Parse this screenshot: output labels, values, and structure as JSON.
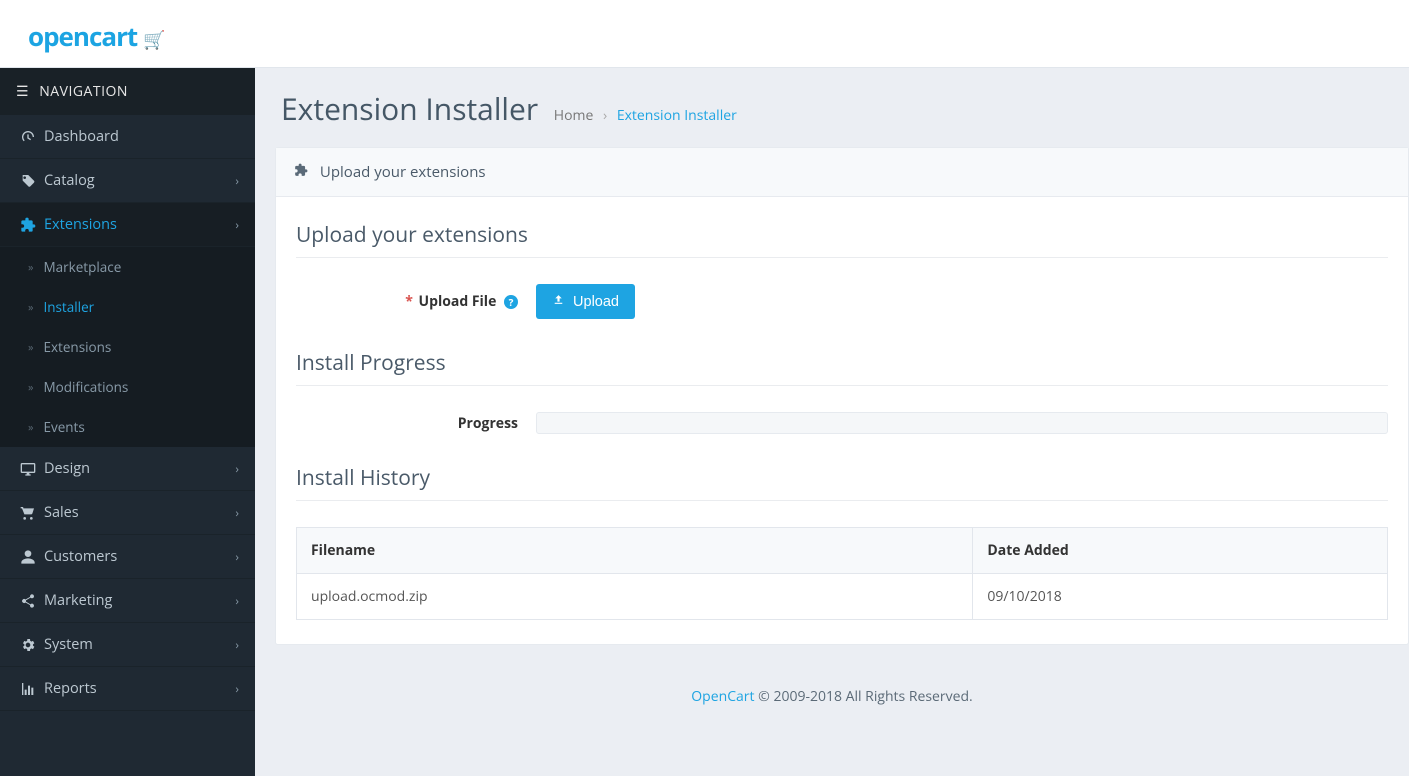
{
  "sidebar": {
    "header": "NAVIGATION",
    "items": [
      {
        "label": "Dashboard",
        "expandable": false
      },
      {
        "label": "Catalog",
        "expandable": true
      },
      {
        "label": "Extensions",
        "expandable": true
      },
      {
        "label": "Design",
        "expandable": true
      },
      {
        "label": "Sales",
        "expandable": true
      },
      {
        "label": "Customers",
        "expandable": true
      },
      {
        "label": "Marketing",
        "expandable": true
      },
      {
        "label": "System",
        "expandable": true
      },
      {
        "label": "Reports",
        "expandable": true
      }
    ],
    "extensions_submenu": [
      {
        "label": "Marketplace"
      },
      {
        "label": "Installer"
      },
      {
        "label": "Extensions"
      },
      {
        "label": "Modifications"
      },
      {
        "label": "Events"
      }
    ]
  },
  "page": {
    "title": "Extension Installer",
    "breadcrumb": {
      "home": "Home",
      "current": "Extension Installer"
    }
  },
  "panel": {
    "heading": "Upload your extensions",
    "upload_section_title": "Upload your extensions",
    "upload_label": "Upload File",
    "upload_button": "Upload",
    "progress_section_title": "Install Progress",
    "progress_label": "Progress",
    "history_section_title": "Install History",
    "table": {
      "columns": {
        "filename": "Filename",
        "date": "Date Added"
      },
      "rows": [
        {
          "filename": "upload.ocmod.zip",
          "date": "09/10/2018"
        }
      ]
    }
  },
  "footer": {
    "brand": "OpenCart",
    "rights": " © 2009-2018 All Rights Reserved."
  },
  "brand": {
    "name": "opencart"
  }
}
